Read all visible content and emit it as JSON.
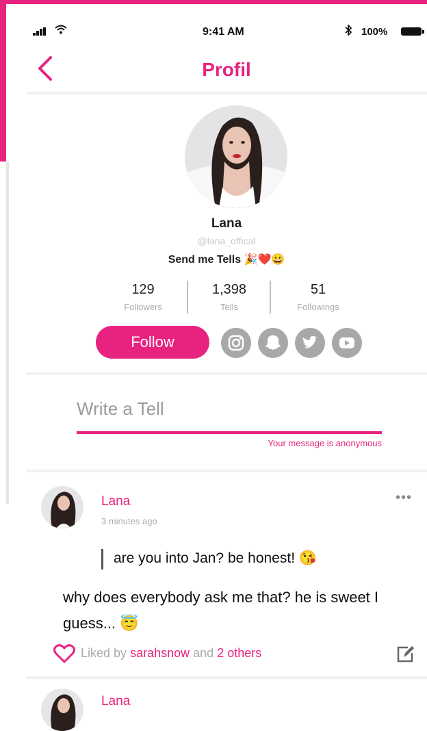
{
  "status_bar": {
    "time": "9:41 AM",
    "battery": "100%"
  },
  "nav": {
    "title": "Profil"
  },
  "profile": {
    "name": "Lana",
    "handle": "@lana_offical",
    "bio": "Send me Tells 🎉❤️😀",
    "stats": [
      {
        "value": "129",
        "label": "Followers"
      },
      {
        "value": "1,398",
        "label": "Tells"
      },
      {
        "value": "51",
        "label": "Followings"
      }
    ],
    "follow_label": "Follow",
    "social_icons": [
      "instagram-icon",
      "snapchat-icon",
      "twitter-icon",
      "youtube-icon"
    ]
  },
  "composer": {
    "placeholder": "Write a Tell",
    "note": "Your message is anonymous"
  },
  "post": {
    "author": "Lana",
    "time": "3 minutes ago",
    "question": "are you into Jan? be honest! 😘",
    "answer": "why does everybody ask me that? he is sweet I guess... 😇",
    "liked_prefix": "Liked by",
    "liked_user": "sarahsnow",
    "liked_and": "and",
    "liked_others": "2 others"
  },
  "next_post": {
    "author": "Lana"
  },
  "colors": {
    "accent": "#e8237f",
    "icon_gray": "#a8a8a8"
  }
}
